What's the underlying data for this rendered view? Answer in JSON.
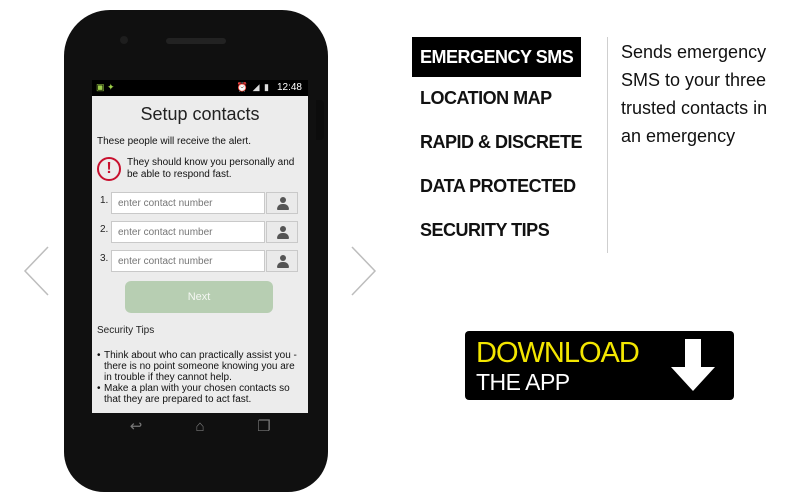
{
  "screen": {
    "status_time": "12:48",
    "title": "Setup contacts",
    "intro": "These people will receive the alert.",
    "warning": "They should know you personally and be able to respond fast.",
    "contacts": [
      {
        "num": "1.",
        "placeholder": "enter contact number"
      },
      {
        "num": "2.",
        "placeholder": "enter contact number"
      },
      {
        "num": "3.",
        "placeholder": "enter contact number"
      }
    ],
    "next_label": "Next",
    "tips_title": "Security Tips",
    "tips": [
      "Think about who can practically assist you - there is no point someone knowing you are in trouble if they cannot help.",
      "Make a plan with your chosen contacts so that they are prepared to act fast."
    ]
  },
  "features": {
    "items": [
      {
        "label": "EMERGENCY SMS",
        "active": true
      },
      {
        "label": "LOCATION MAP",
        "active": false
      },
      {
        "label": "RAPID & DISCRETE",
        "active": false
      },
      {
        "label": "DATA PROTECTED",
        "active": false
      },
      {
        "label": "SECURITY TIPS",
        "active": false
      }
    ],
    "description": "Sends emergency SMS to your three trusted contacts in an emergency"
  },
  "download": {
    "line1": "DOWNLOAD",
    "line2": "THE APP"
  },
  "colors": {
    "accent_yellow": "#f3e600",
    "warning_red": "#c8102e",
    "next_button": "#b7ceb2"
  },
  "icons": {
    "carousel_prev": "chevron-left-icon",
    "carousel_next": "chevron-right-icon",
    "download": "arrow-down-icon"
  }
}
